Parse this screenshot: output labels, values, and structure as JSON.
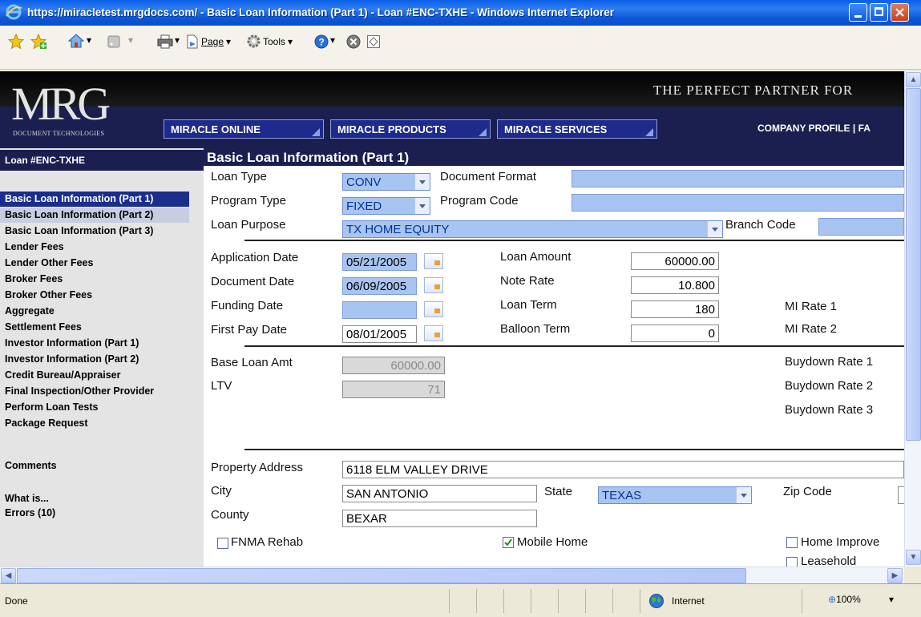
{
  "window": {
    "title": "https://miracletest.mrgdocs.com/ - Basic Loan Information (Part 1) - Loan #ENC-TXHE - Windows Internet Explorer"
  },
  "toolbar": {
    "page_label": "Page",
    "tools_label": "Tools"
  },
  "header": {
    "logo_text": "MRG",
    "logo_subtext": "DOCUMENT TECHNOLOGIES",
    "tagline": "THE PERFECT PARTNER FOR",
    "nav": [
      "MIRACLE ONLINE",
      "MIRACLE PRODUCTS",
      "MIRACLE SERVICES"
    ],
    "toplinks": "COMPANY PROFILE  |  FA"
  },
  "sidebar": {
    "loan_id": "Loan #ENC-TXHE",
    "items": [
      "Basic Loan Information (Part 1)",
      "Basic Loan Information (Part 2)",
      "Basic Loan Information (Part 3)",
      "Lender Fees",
      "Lender Other Fees",
      "Broker Fees",
      "Broker Other Fees",
      "Aggregate",
      "Settlement Fees",
      "Investor Information (Part 1)",
      "Investor Information (Part 2)",
      "Credit Bureau/Appraiser",
      "Final Inspection/Other Provider",
      "Perform Loan Tests",
      "Package Request"
    ],
    "comments": "Comments",
    "what_is": "What is...",
    "errors": "Errors (10)"
  },
  "form": {
    "title": "Basic Loan Information (Part 1)",
    "loan_type": {
      "label": "Loan Type",
      "value": "CONV"
    },
    "document_format": {
      "label": "Document Format",
      "value": ""
    },
    "program_type": {
      "label": "Program Type",
      "value": "FIXED"
    },
    "program_code": {
      "label": "Program Code",
      "value": ""
    },
    "loan_purpose": {
      "label": "Loan Purpose",
      "value": "TX HOME EQUITY"
    },
    "branch_code": {
      "label": "Branch Code",
      "value": ""
    },
    "application_date": {
      "label": "Application Date",
      "value": "05/21/2005"
    },
    "document_date": {
      "label": "Document Date",
      "value": "06/09/2005"
    },
    "funding_date": {
      "label": "Funding Date",
      "value": ""
    },
    "first_pay_date": {
      "label": "First Pay Date",
      "value": "08/01/2005"
    },
    "loan_amount": {
      "label": "Loan Amount",
      "value": "60000.00"
    },
    "note_rate": {
      "label": "Note Rate",
      "value": "10.800"
    },
    "loan_term": {
      "label": "Loan Term",
      "value": "180"
    },
    "balloon_term": {
      "label": "Balloon Term",
      "value": "0"
    },
    "mi_rate_1": {
      "label": "MI Rate 1"
    },
    "mi_rate_2": {
      "label": "MI Rate 2"
    },
    "base_loan_amt": {
      "label": "Base Loan Amt",
      "value": "60000.00"
    },
    "ltv": {
      "label": "LTV",
      "value": "71"
    },
    "buydown_rate_1": {
      "label": "Buydown Rate 1"
    },
    "buydown_rate_2": {
      "label": "Buydown Rate 2"
    },
    "buydown_rate_3": {
      "label": "Buydown Rate 3"
    },
    "property_address": {
      "label": "Property Address",
      "value": "6118 ELM VALLEY DRIVE"
    },
    "city": {
      "label": "City",
      "value": "SAN ANTONIO"
    },
    "state": {
      "label": "State",
      "value": "TEXAS"
    },
    "zip_code": {
      "label": "Zip Code",
      "value": ""
    },
    "county": {
      "label": "County",
      "value": "BEXAR"
    },
    "fnma_rehab": {
      "label": "FNMA Rehab",
      "checked": false
    },
    "mobile_home": {
      "label": "Mobile Home",
      "checked": true
    },
    "home_improvement": {
      "label": "Home Improve",
      "checked": false
    },
    "leasehold": {
      "label": "Leasehold",
      "checked": false
    }
  },
  "status": {
    "text": "Done",
    "zone": "Internet",
    "zoom": "100%"
  },
  "colors": {
    "titlebar": "#0A5FE8",
    "header_navy": "#1A1F50",
    "selected_nav": "#1A2E8C",
    "field_blue": "#A8C4F0"
  }
}
